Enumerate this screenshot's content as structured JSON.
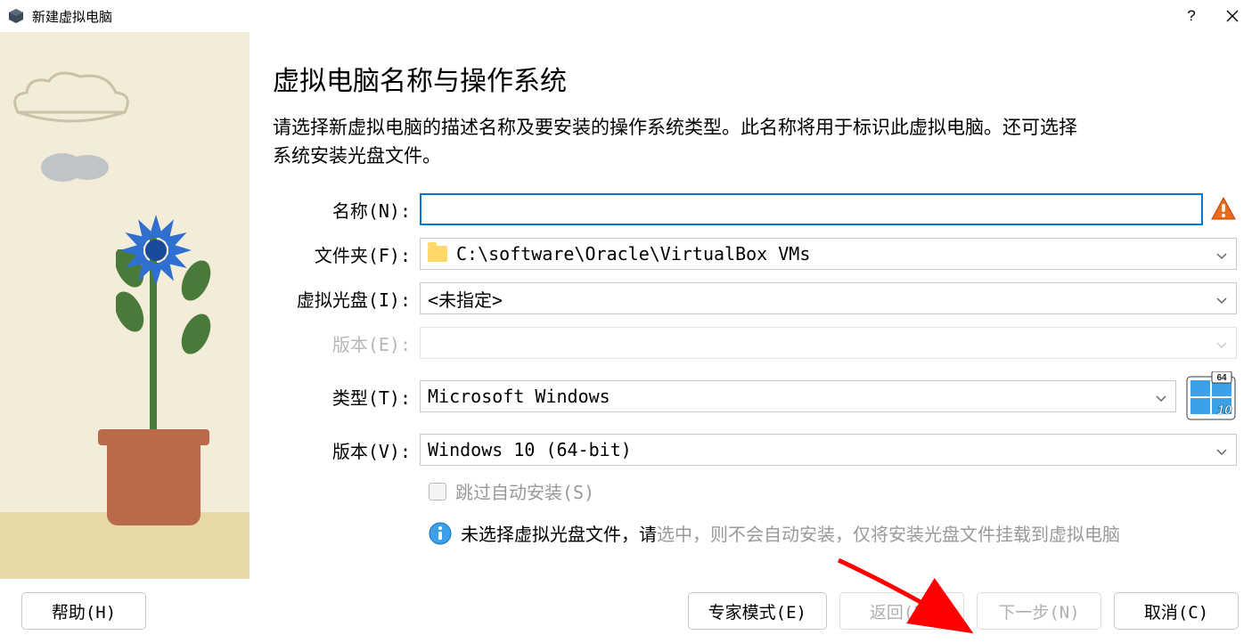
{
  "window": {
    "title": "新建虚拟电脑"
  },
  "page": {
    "heading": "虚拟电脑名称与操作系统",
    "description": "请选择新虚拟电脑的描述名称及要安装的操作系统类型。此名称将用于标识此虚拟电脑。还可选择系统安装光盘文件。"
  },
  "form": {
    "name_label": "名称(N):",
    "name_value": "",
    "folder_label": "文件夹(F):",
    "folder_value": "C:\\software\\Oracle\\VirtualBox VMs",
    "iso_label": "虚拟光盘(I):",
    "iso_value": "<未指定>",
    "edition_label": "版本(E):",
    "edition_value": "",
    "type_label": "类型(T):",
    "type_value": "Microsoft Windows",
    "version_label": "版本(V):",
    "version_value": "Windows 10 (64-bit)",
    "skip_label": "跳过自动安装(S)",
    "os_badge": "64 10"
  },
  "info": {
    "text1": "未选择虚拟光盘文件，请 ",
    "text2": "选中，则不会自动安装，仅将安装光盘文件挂载到虚拟电脑"
  },
  "footer": {
    "help": "帮助(H)",
    "expert": "专家模式(E)",
    "back": "返回(B)",
    "next": "下一步(N)",
    "cancel": "取消(C)"
  }
}
